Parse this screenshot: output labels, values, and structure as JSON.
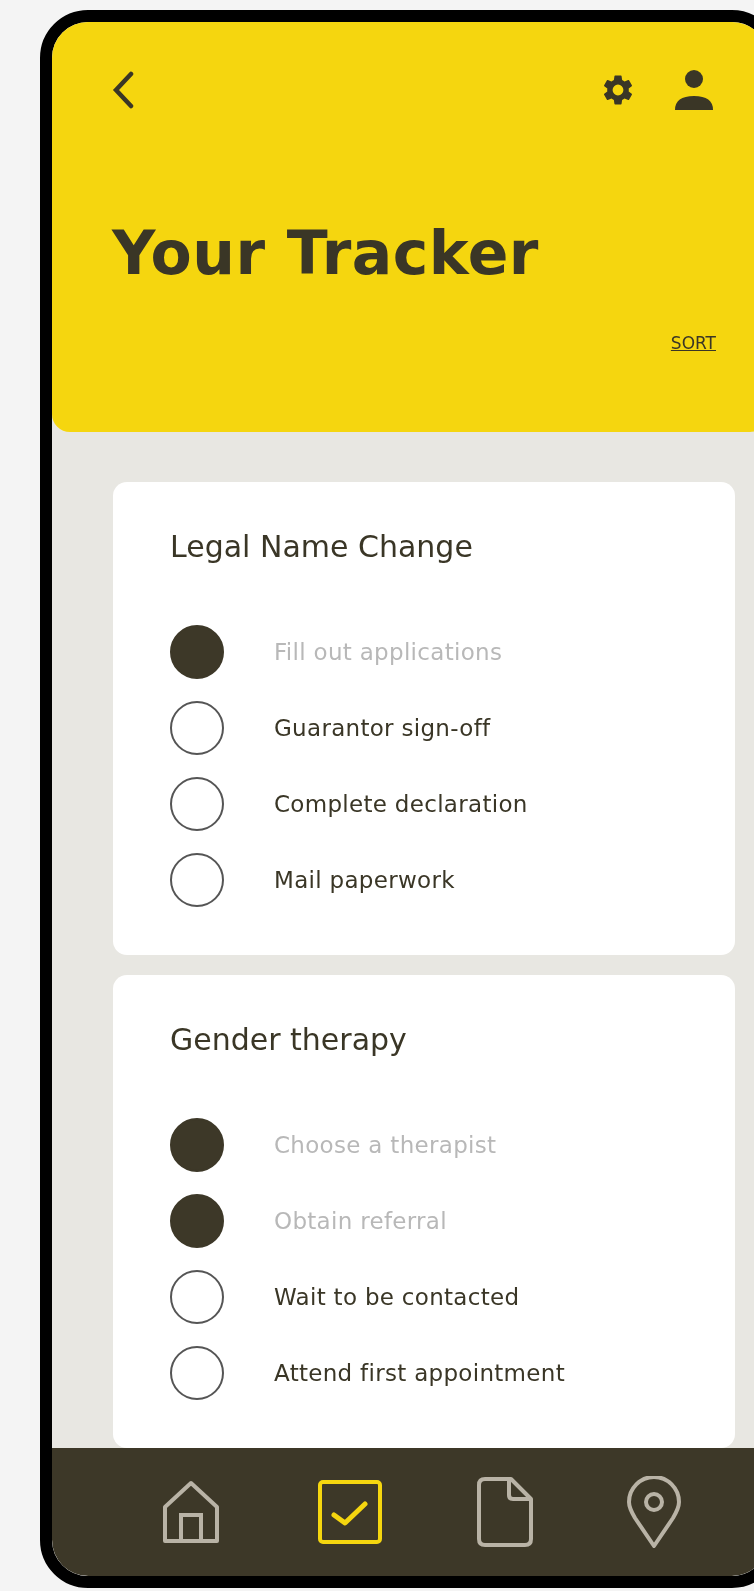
{
  "header": {
    "title": "Your Tracker",
    "sort_link": "SORT"
  },
  "cards": [
    {
      "title": "Legal Name Change",
      "tasks": [
        {
          "label": "Fill out applications",
          "checked": true
        },
        {
          "label": "Guarantor sign-off",
          "checked": false
        },
        {
          "label": "Complete declaration",
          "checked": false
        },
        {
          "label": "Mail paperwork",
          "checked": false
        }
      ]
    },
    {
      "title": "Gender therapy",
      "tasks": [
        {
          "label": "Choose a therapist",
          "checked": true
        },
        {
          "label": "Obtain referral",
          "checked": true
        },
        {
          "label": "Wait to be contacted",
          "checked": false
        },
        {
          "label": "Attend first appointment",
          "checked": false
        }
      ]
    }
  ],
  "bottom_nav": [
    {
      "kind": "home",
      "selected": false
    },
    {
      "kind": "tracker",
      "selected": true
    },
    {
      "kind": "document",
      "selected": false
    },
    {
      "kind": "location",
      "selected": false
    }
  ]
}
